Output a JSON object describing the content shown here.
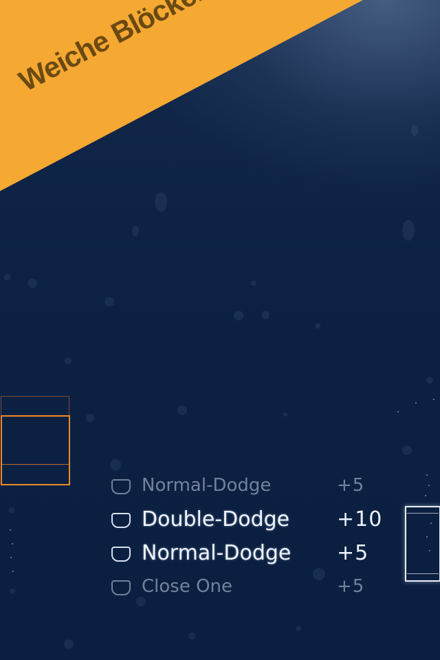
{
  "banner": {
    "text": "Weiche Blöcken aus",
    "background_color": "#f5a832",
    "text_color": "#6b4a12"
  },
  "background": {
    "color_top": "#13294a",
    "color_bottom": "#0b1f40"
  },
  "player_colors": {
    "left_block": "#f08a24",
    "right_block": "#e8eef8"
  },
  "score_feed": [
    {
      "icon": "shield-icon",
      "label": "Normal-Dodge",
      "points": "+5",
      "faded": true
    },
    {
      "icon": "shield-icon",
      "label": "Double-Dodge",
      "points": "+10",
      "faded": false
    },
    {
      "icon": "shield-icon",
      "label": "Normal-Dodge",
      "points": "+5",
      "faded": false
    },
    {
      "icon": "shield-icon",
      "label": "Close One",
      "points": "+5",
      "faded": true
    }
  ]
}
